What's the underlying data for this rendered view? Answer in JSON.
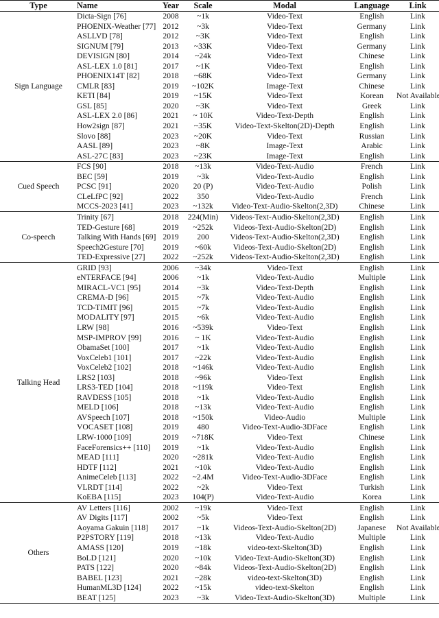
{
  "table": {
    "columns": [
      {
        "key": "type",
        "label": "Type"
      },
      {
        "key": "name",
        "label": "Name"
      },
      {
        "key": "year",
        "label": "Year"
      },
      {
        "key": "scale",
        "label": "Scale"
      },
      {
        "key": "modal",
        "label": "Modal"
      },
      {
        "key": "language",
        "label": "Language"
      },
      {
        "key": "link",
        "label": "Link"
      }
    ],
    "sections": [
      {
        "type": "Sign Language",
        "rows": [
          {
            "name": "Dicta-Sign [76]",
            "year": "2008",
            "scale": "~1k",
            "modal": "Video-Text",
            "language": "English",
            "link": "Link"
          },
          {
            "name": "PHOENIX-Weather [77]",
            "year": "2012",
            "scale": "~3k",
            "modal": "Video-Text",
            "language": "Germany",
            "link": "Link"
          },
          {
            "name": "ASLLVD [78]",
            "year": "2012",
            "scale": "~3K",
            "modal": "Video-Text",
            "language": "English",
            "link": "Link"
          },
          {
            "name": "SIGNUM [79]",
            "year": "2013",
            "scale": "~33K",
            "modal": "Video-Text",
            "language": "Germany",
            "link": "Link"
          },
          {
            "name": "DEVISIGN [80]",
            "year": "2014",
            "scale": "~24k",
            "modal": "Video-Text",
            "language": "Chinese",
            "link": "Link"
          },
          {
            "name": "ASL-LEX 1.0 [81]",
            "year": "2017",
            "scale": "~1K",
            "modal": "Video-Text",
            "language": "English",
            "link": "Link"
          },
          {
            "name": "PHOENIX14T [82]",
            "year": "2018",
            "scale": "~68K",
            "modal": "Video-Text",
            "language": "Germany",
            "link": "Link"
          },
          {
            "name": "CMLR [83]",
            "year": "2019",
            "scale": "~102K",
            "modal": "Image-Text",
            "language": "Chinese",
            "link": "Link"
          },
          {
            "name": "KETI [84]",
            "year": "2019",
            "scale": "~15K",
            "modal": "Video-Text",
            "language": "Korean",
            "link": "Not Available"
          },
          {
            "name": "GSL [85]",
            "year": "2020",
            "scale": "~3K",
            "modal": "Video-Text",
            "language": "Greek",
            "link": "Link"
          },
          {
            "name": "ASL-LEX 2.0 [86]",
            "year": "2021",
            "scale": "~ 10K",
            "modal": "Video-Text-Depth",
            "language": "English",
            "link": "Link"
          },
          {
            "name": "How2sign [87]",
            "year": "2021",
            "scale": "~35K",
            "modal": "Video-Text-Skelton(2D)-Depth",
            "language": "English",
            "link": "Link"
          },
          {
            "name": "Slovo [88]",
            "year": "2023",
            "scale": "~20K",
            "modal": "Video-Text",
            "language": "Russian",
            "link": "Link"
          },
          {
            "name": "AASL [89]",
            "year": "2023",
            "scale": "~8K",
            "modal": "Image-Text",
            "language": "Arabic",
            "link": "Link"
          },
          {
            "name": "ASL-27C [83]",
            "year": "2023",
            "scale": "~23K",
            "modal": "Image-Text",
            "language": "English",
            "link": "Link"
          }
        ]
      },
      {
        "type": "Cued Speech",
        "rows": [
          {
            "name": "FCS [90]",
            "year": "2018",
            "scale": "~13k",
            "modal": "Video-Text-Audio",
            "language": "French",
            "link": "Link"
          },
          {
            "name": "BEC [59]",
            "year": "2019",
            "scale": "~3k",
            "modal": "Video-Text-Audio",
            "language": "English",
            "link": "Link"
          },
          {
            "name": "PCSC [91]",
            "year": "2020",
            "scale": "20 (P)",
            "modal": "Video-Text-Audio",
            "language": "Polish",
            "link": "Link"
          },
          {
            "name": "CLeLfPC [92]",
            "year": "2022",
            "scale": "350",
            "modal": "Video-Text-Audio",
            "language": "French",
            "link": "Link"
          },
          {
            "name": "MCCS-2023 [41]",
            "year": "2023",
            "scale": "~132k",
            "modal": "Video-Text-Audio-Skelton(2,3D)",
            "language": "Chinese",
            "link": "Link"
          }
        ]
      },
      {
        "type": "Co-speech",
        "rows": [
          {
            "name": "Trinity [67]",
            "year": "2018",
            "scale": "224(Min)",
            "modal": "Videos-Text-Audio-Skelton(2,3D)",
            "language": "English",
            "link": "Link"
          },
          {
            "name": "TED-Gesture [68]",
            "year": "2019",
            "scale": "~252k",
            "modal": "Videos-Text-Audio-Skelton(2D)",
            "language": "English",
            "link": "Link"
          },
          {
            "name": "Talking With Hands [69]",
            "year": "2019",
            "scale": "200",
            "modal": "Videos-Text-Audio-Skelton(2,3D)",
            "language": "English",
            "link": "Link"
          },
          {
            "name": "Speech2Gesture [70]",
            "year": "2019",
            "scale": "~60k",
            "modal": "Videos-Text-Audio-Skelton(2D)",
            "language": "English",
            "link": "Link"
          },
          {
            "name": "TED-Expressive [27]",
            "year": "2022",
            "scale": "~252k",
            "modal": "Videos-Text-Audio-Skelton(2,3D)",
            "language": "English",
            "link": "Link"
          }
        ]
      },
      {
        "type": "Talking Head",
        "rows": [
          {
            "name": "GRID [93]",
            "year": "2006",
            "scale": "~34k",
            "modal": "Video-Text",
            "language": "English",
            "link": "Link"
          },
          {
            "name": "eNTERFACE [94]",
            "year": "2006",
            "scale": "~1k",
            "modal": "Video-Text-Audio",
            "language": "Multiple",
            "link": "Link"
          },
          {
            "name": "MIRACL-VC1 [95]",
            "year": "2014",
            "scale": "~3k",
            "modal": "Video-Text-Depth",
            "language": "English",
            "link": "Link"
          },
          {
            "name": "CREMA-D [96]",
            "year": "2015",
            "scale": "~7k",
            "modal": "Video-Text-Audio",
            "language": "English",
            "link": "Link"
          },
          {
            "name": "TCD-TIMIT [96]",
            "year": "2015",
            "scale": "~7k",
            "modal": "Video-Text-Audio",
            "language": "English",
            "link": "Link"
          },
          {
            "name": "MODALITY [97]",
            "year": "2015",
            "scale": "~6k",
            "modal": "Video-Text-Audio",
            "language": "English",
            "link": "Link"
          },
          {
            "name": "LRW [98]",
            "year": "2016",
            "scale": "~539k",
            "modal": "Video-Text",
            "language": "English",
            "link": "Link"
          },
          {
            "name": "MSP-IMPROV [99]",
            "year": "2016",
            "scale": "~ 1K",
            "modal": "Video-Text-Audio",
            "language": "English",
            "link": "Link"
          },
          {
            "name": "ObamaSet [100]",
            "year": "2017",
            "scale": "~1k",
            "modal": "Video-Text-Audio",
            "language": "English",
            "link": "Link"
          },
          {
            "name": "VoxCeleb1 [101]",
            "year": "2017",
            "scale": "~22k",
            "modal": "Video-Text-Audio",
            "language": "English",
            "link": "Link"
          },
          {
            "name": "VoxCeleb2 [102]",
            "year": "2018",
            "scale": "~146k",
            "modal": "Video-Text-Audio",
            "language": "English",
            "link": "Link"
          },
          {
            "name": "LRS2 [103]",
            "year": "2018",
            "scale": "~96k",
            "modal": "Video-Text",
            "language": "English",
            "link": "Link"
          },
          {
            "name": "LRS3-TED [104]",
            "year": "2018",
            "scale": "~119k",
            "modal": "Video-Text",
            "language": "English",
            "link": "Link"
          },
          {
            "name": "RAVDESS [105]",
            "year": "2018",
            "scale": "~1k",
            "modal": "Video-Text-Audio",
            "language": "English",
            "link": "Link"
          },
          {
            "name": "MELD [106]",
            "year": "2018",
            "scale": "~13k",
            "modal": "Video-Text-Audio",
            "language": "English",
            "link": "Link"
          },
          {
            "name": "AVSpeech [107]",
            "year": "2018",
            "scale": "~150k",
            "modal": "Video-Audio",
            "language": "Multiple",
            "link": "Link"
          },
          {
            "name": "VOCASET [108]",
            "year": "2019",
            "scale": "480",
            "modal": "Video-Text-Audio-3DFace",
            "language": "English",
            "link": "Link"
          },
          {
            "name": "LRW-1000 [109]",
            "year": "2019",
            "scale": "~718K",
            "modal": "Video-Text",
            "language": "Chinese",
            "link": "Link"
          },
          {
            "name": "FaceForensics++ [110]",
            "year": "2019",
            "scale": "~1k",
            "modal": "Video-Text-Audio",
            "language": "English",
            "link": "Link"
          },
          {
            "name": "MEAD [111]",
            "year": "2020",
            "scale": "~281k",
            "modal": "Video-Text-Audio",
            "language": "English",
            "link": "Link"
          },
          {
            "name": "HDTF [112]",
            "year": "2021",
            "scale": "~10k",
            "modal": "Video-Text-Audio",
            "language": "English",
            "link": "Link"
          },
          {
            "name": "AnimeCeleb [113]",
            "year": "2022",
            "scale": "~2.4M",
            "modal": "Video-Text-Audio-3DFace",
            "language": "English",
            "link": "Link"
          },
          {
            "name": "VLRDT [114]",
            "year": "2022",
            "scale": "~2k",
            "modal": "Video-Text",
            "language": "Turkish",
            "link": "Link"
          },
          {
            "name": "KoEBA [115]",
            "year": "2023",
            "scale": "104(P)",
            "modal": "Video-Text-Audio",
            "language": "Korea",
            "link": "Link"
          }
        ]
      },
      {
        "type": "Others",
        "rows": [
          {
            "name": "AV Letters [116]",
            "year": "2002",
            "scale": "~19k",
            "modal": "Video-Text",
            "language": "English",
            "link": "Link"
          },
          {
            "name": "AV Digits [117]",
            "year": "2002",
            "scale": "~5k",
            "modal": "Video-Text",
            "language": "English",
            "link": "Link"
          },
          {
            "name": "Aoyama Gakuin [118]",
            "year": "2017",
            "scale": "~1k",
            "modal": "Videos-Text-Audio-Skelton(2D)",
            "language": "Japanese",
            "link": "Not Available"
          },
          {
            "name": "P2PSTORY [119]",
            "year": "2018",
            "scale": "~13k",
            "modal": "Video-Text-Audio",
            "language": "Multiple",
            "link": "Link"
          },
          {
            "name": "AMASS [120]",
            "year": "2019",
            "scale": "~18k",
            "modal": "video-text-Skelton(3D)",
            "language": "English",
            "link": "Link"
          },
          {
            "name": "BoLD [121]",
            "year": "2020",
            "scale": "~10k",
            "modal": "Video-Text-Audio-Skelton(3D)",
            "language": "English",
            "link": "Link"
          },
          {
            "name": "PATS [122]",
            "year": "2020",
            "scale": "~84k",
            "modal": "Videos-Text-Audio-Skelton(2D)",
            "language": "English",
            "link": "Link"
          },
          {
            "name": "BABEL [123]",
            "year": "2021",
            "scale": "~28k",
            "modal": "video-text-Skelton(3D)",
            "language": "English",
            "link": "Link"
          },
          {
            "name": "HumanML3D [124]",
            "year": "2022",
            "scale": "~15k",
            "modal": "video-text-Skelton",
            "language": "English",
            "link": "Link"
          },
          {
            "name": "BEAT [125]",
            "year": "2023",
            "scale": "~3k",
            "modal": "Video-Text-Audio-Skelton(3D)",
            "language": "Multiple",
            "link": "Link"
          }
        ]
      }
    ]
  }
}
